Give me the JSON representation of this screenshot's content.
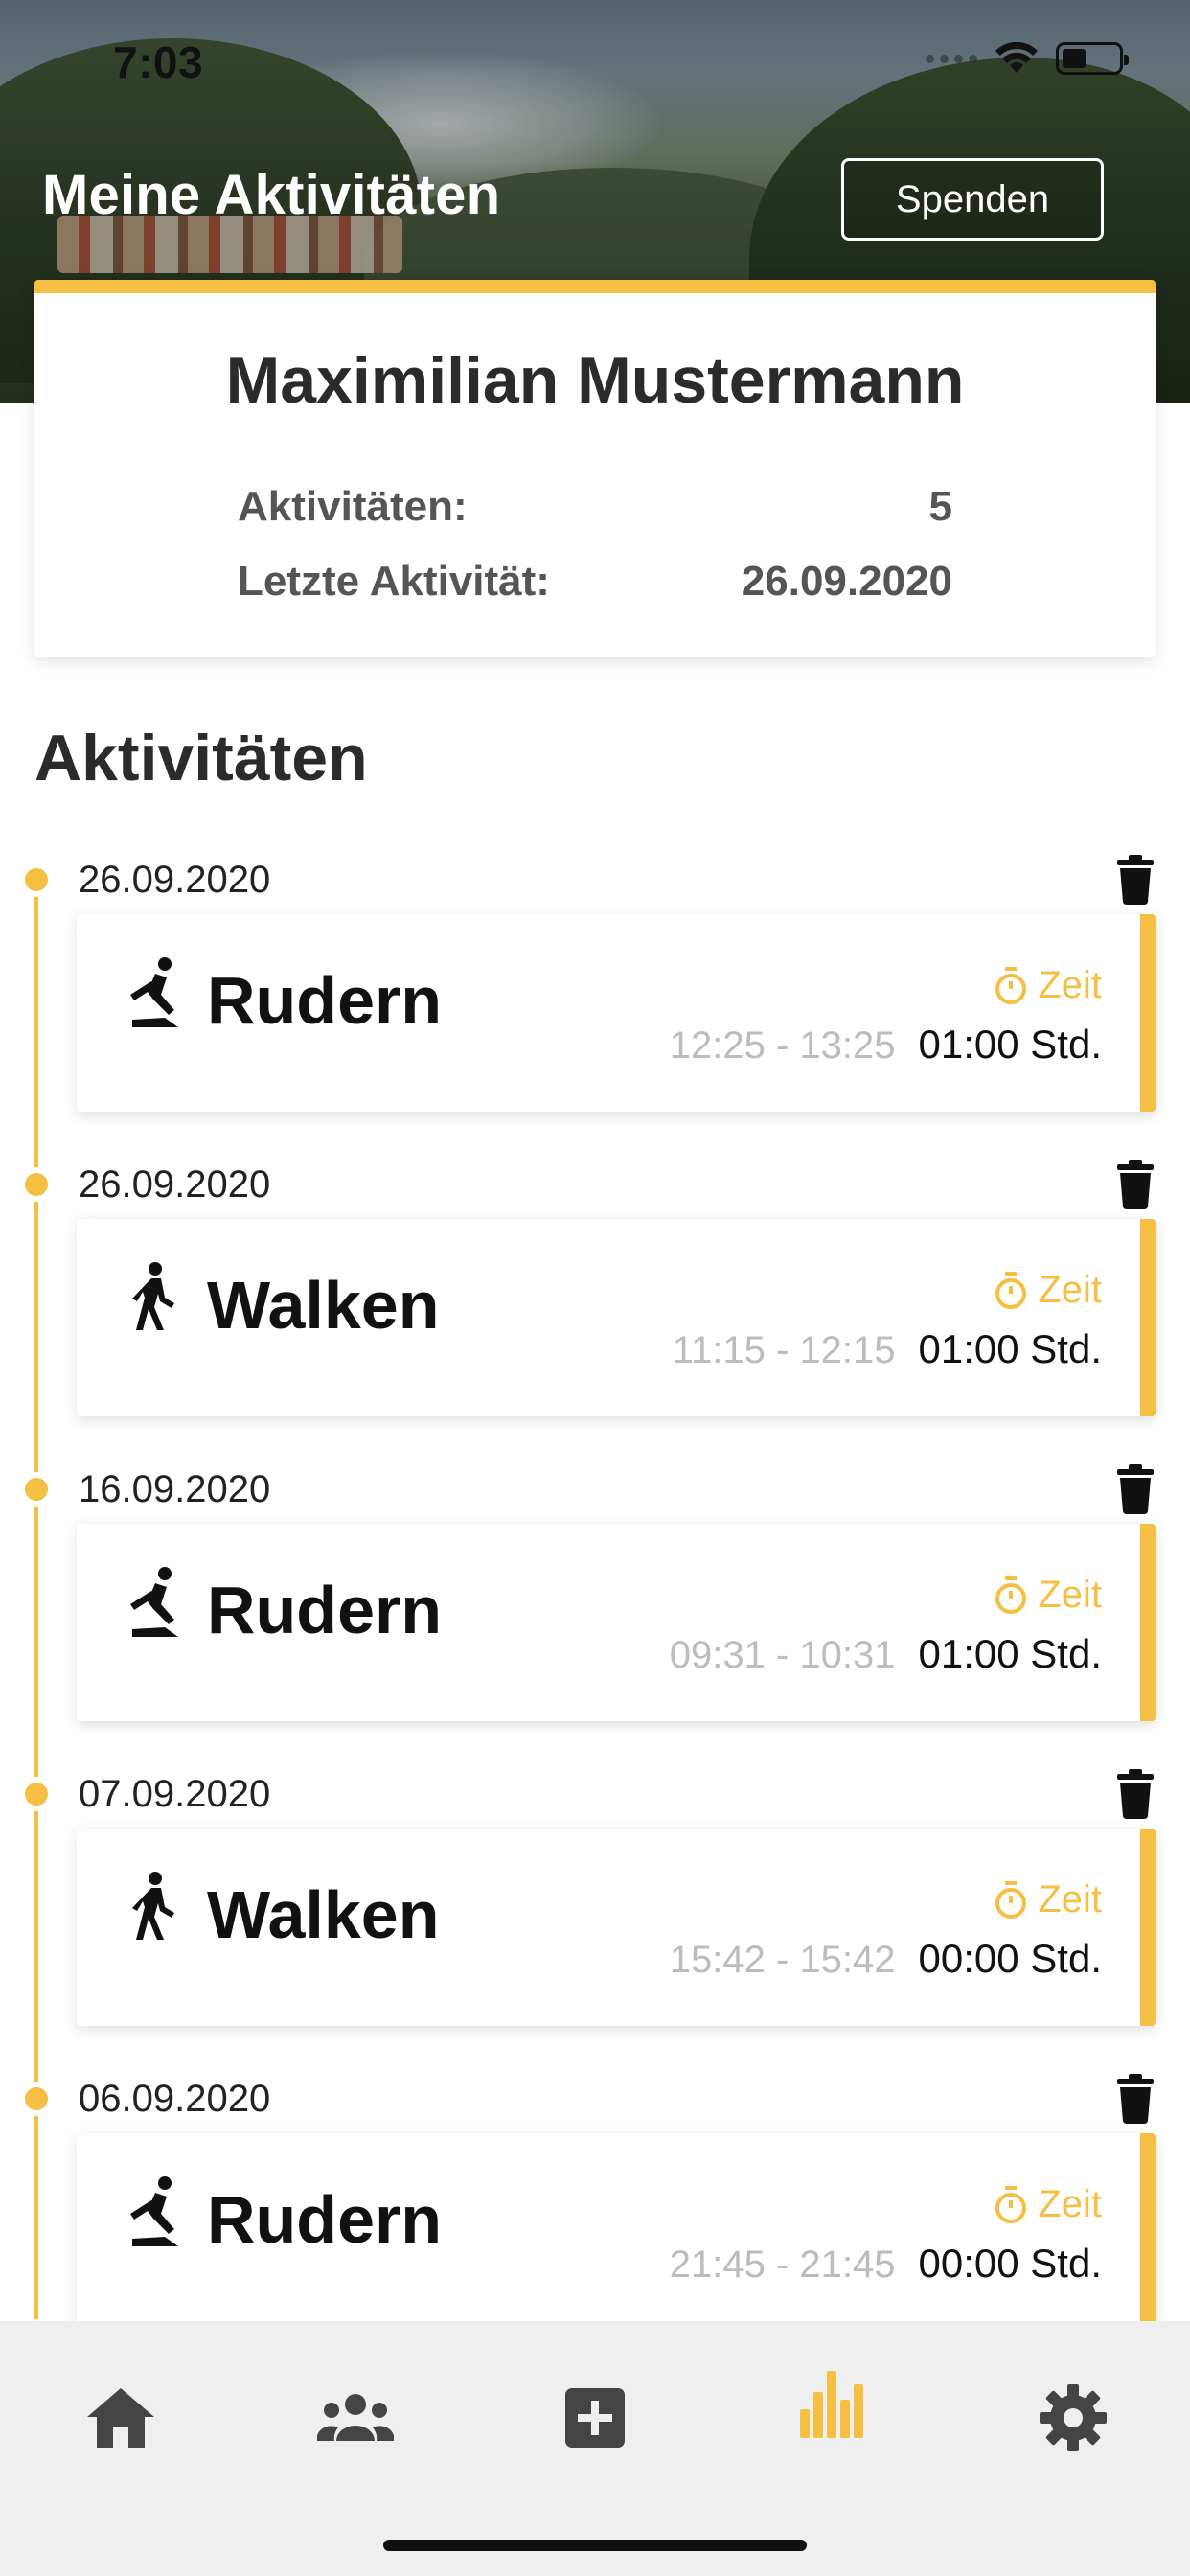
{
  "status_bar": {
    "time": "7:03"
  },
  "header": {
    "title": "Meine Aktivitäten",
    "donate_label": "Spenden"
  },
  "profile": {
    "name": "Maximilian Mustermann",
    "activities_label": "Aktivitäten:",
    "activities_value": "5",
    "last_activity_label": "Letzte Aktivität:",
    "last_activity_value": "26.09.2020"
  },
  "section_title": "Aktivitäten",
  "activities": [
    {
      "date": "26.09.2020",
      "type": "Rudern",
      "icon": "rowing-icon",
      "zeit_label": "Zeit",
      "range": "12:25 - 13:25",
      "duration": "01:00 Std."
    },
    {
      "date": "26.09.2020",
      "type": "Walken",
      "icon": "walking-icon",
      "zeit_label": "Zeit",
      "range": "11:15 - 12:15",
      "duration": "01:00 Std."
    },
    {
      "date": "16.09.2020",
      "type": "Rudern",
      "icon": "rowing-icon",
      "zeit_label": "Zeit",
      "range": "09:31 - 10:31",
      "duration": "01:00 Std."
    },
    {
      "date": "07.09.2020",
      "type": "Walken",
      "icon": "walking-icon",
      "zeit_label": "Zeit",
      "range": "15:42 - 15:42",
      "duration": "00:00 Std."
    },
    {
      "date": "06.09.2020",
      "type": "Rudern",
      "icon": "rowing-icon",
      "zeit_label": "Zeit",
      "range": "21:45 - 21:45",
      "duration": "00:00 Std."
    }
  ],
  "bottom_nav": {
    "items": [
      "home-icon",
      "group-icon",
      "add-box-icon",
      "bar-chart-icon",
      "gear-icon"
    ],
    "active": "bar-chart-icon"
  },
  "colors": {
    "accent": "#f4bf42",
    "text_dark": "#222222",
    "muted": "#bcbcbc",
    "nav_bg": "#efefef",
    "nav_icon": "#444444"
  }
}
